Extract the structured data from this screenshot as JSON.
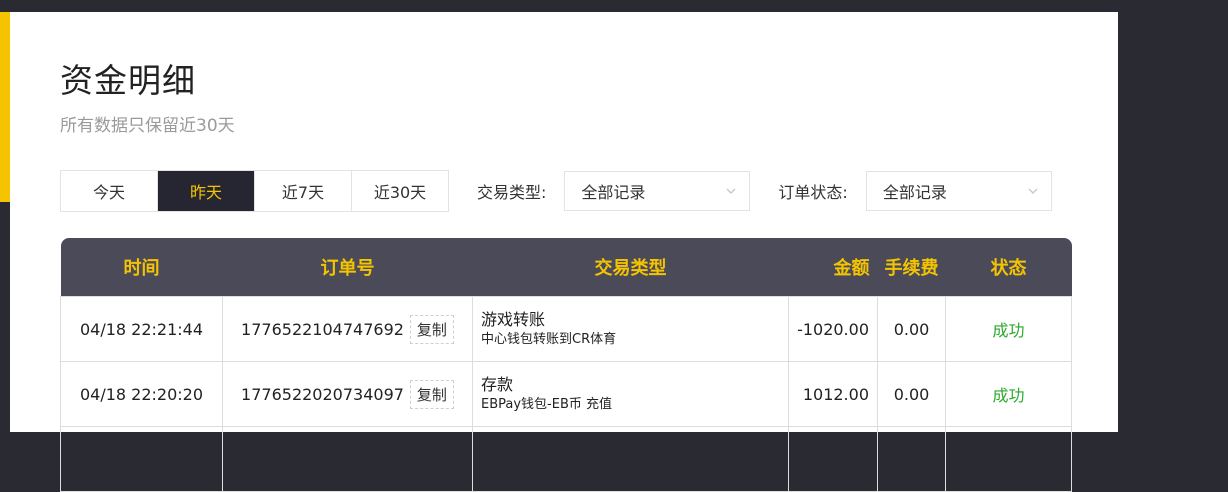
{
  "page": {
    "title": "资金明细",
    "subtitle": "所有数据只保留近30天"
  },
  "filters": {
    "date_tabs": [
      {
        "label": "今天",
        "active": false
      },
      {
        "label": "昨天",
        "active": true
      },
      {
        "label": "近7天",
        "active": false
      },
      {
        "label": "近30天",
        "active": false
      }
    ],
    "transaction_type": {
      "label": "交易类型:",
      "value": "全部记录"
    },
    "order_status": {
      "label": "订单状态:",
      "value": "全部记录"
    }
  },
  "table": {
    "headers": [
      "时间",
      "订单号",
      "交易类型",
      "金额",
      "手续费",
      "状态"
    ],
    "copy_label": "复制",
    "rows": [
      {
        "time": "04/18 22:21:44",
        "order_no": "1776522104747692",
        "type_main": "游戏转账",
        "type_sub": "中心钱包转账到CR体育",
        "amount": "-1020.00",
        "fee": "0.00",
        "status": "成功"
      },
      {
        "time": "04/18 22:20:20",
        "order_no": "1776522020734097",
        "type_main": "存款",
        "type_sub": "EBPay钱包-EB币 充值",
        "amount": "1012.00",
        "fee": "0.00",
        "status": "成功"
      }
    ]
  },
  "colors": {
    "accent": "#f5c400",
    "header_bg": "#4a4a58",
    "active_tab_bg": "#262633",
    "success": "#2ea82e"
  }
}
